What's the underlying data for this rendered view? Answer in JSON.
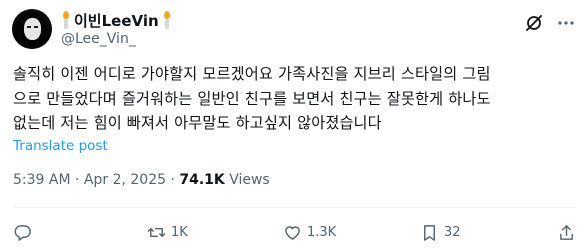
{
  "post": {
    "author": {
      "display_name": "이빈LeeVin",
      "handle": "@Lee_Vin_"
    },
    "text_lines": [
      "솔직히 이젠 어디로 가야할지 모르겠어요 가족사진을 지브리 스타일의 그림",
      "으로 만들었다며 즐거워하는 일반인 친구를 보면서 친구는 잘못한게 하나도",
      "없는데 저는 힘이 빠져서 아무말도 하고싶지 않아졌습니다"
    ],
    "translate_label": "Translate post",
    "timestamp": "5:39 AM · Apr 2, 2025 · ",
    "views_count": "74.1K",
    "views_label": " Views"
  },
  "actions": {
    "reply": "",
    "retweet": "1K",
    "like": "1.3K",
    "views": "32"
  },
  "icons": {
    "grok": "grok-icon",
    "more": "more-horizontal-icon",
    "reply": "reply-icon",
    "retweet": "retweet-icon",
    "like": "heart-icon",
    "views": "views-bar-icon",
    "share": "share-icon"
  },
  "colors": {
    "link": "#1d9bf0",
    "muted": "#536471",
    "text": "#0f1419"
  }
}
